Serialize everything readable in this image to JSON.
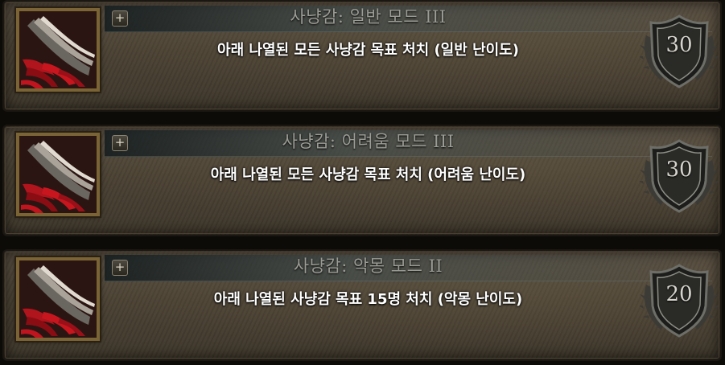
{
  "achievements": [
    {
      "title": "사냥감: 일반 모드 III",
      "description": "아래 나열된 모든 사냥감 목표 처치 (일반 난이도)",
      "points": "30"
    },
    {
      "title": "사냥감: 어려움 모드 III",
      "description": "아래 나열된 모든 사냥감 목표 처치 (어려움 난이도)",
      "points": "30"
    },
    {
      "title": "사냥감: 악몽 모드 II",
      "description": "아래 나열된 사냥감 목표 15명 처치 (악몽 난이도)",
      "points": "20"
    }
  ],
  "expand_label": "+",
  "icon": "claw-slash-icon",
  "badge_icon": "shield-laurel-icon",
  "colors": {
    "title": "#9c9c96",
    "description": "#ffffff",
    "frame_gold": "#7a6436",
    "icon_red": "#b0141c"
  }
}
